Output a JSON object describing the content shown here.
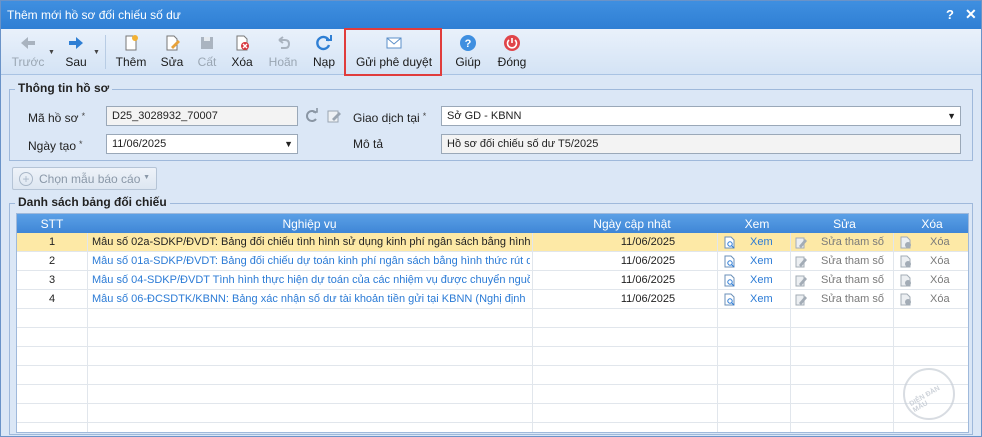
{
  "window": {
    "title": "Thêm mới hồ sơ đối chiếu số dư",
    "help": "?",
    "close": "✕"
  },
  "toolbar": {
    "prev": "Trước",
    "next": "Sau",
    "add": "Thêm",
    "edit": "Sửa",
    "save": "Cất",
    "delete": "Xóa",
    "undo": "Hoãn",
    "reload": "Nạp",
    "send": "Gửi phê duyệt",
    "help": "Giúp",
    "close": "Đóng"
  },
  "info": {
    "legend": "Thông tin hồ sơ",
    "code_label": "Mã hồ sơ",
    "code_value": "D25_3028932_70007",
    "date_label": "Ngày tạo",
    "date_value": "11/06/2025",
    "place_label": "Giao dịch tại",
    "place_value": "Sở GD - KBNN",
    "desc_label": "Mô tả",
    "desc_value": "Hồ sơ đối chiếu số dư T5/2025",
    "required_mark": "*"
  },
  "chooser": {
    "label": "Chọn mẫu báo cáo"
  },
  "list": {
    "legend": "Danh sách bảng đối chiếu",
    "headers": {
      "stt": "STT",
      "nv": "Nghiệp vụ",
      "date": "Ngày cập nhật",
      "view": "Xem",
      "edit": "Sửa",
      "del": "Xóa"
    },
    "rows": [
      {
        "stt": "1",
        "nv": "Mẫu số 02a-SDKP/ĐVDT: Bảng đối chiếu tình hình sử dụng kinh phí ngân sách bằng hình",
        "date": "11/06/2025",
        "view": "Xem",
        "edit": "Sửa tham số",
        "del": "Xóa"
      },
      {
        "stt": "2",
        "nv": "Mẫu số 01a-SDKP/ĐVDT: Bảng đối chiếu dự toán kinh phí ngân sách bằng hình thức rút d",
        "date": "11/06/2025",
        "view": "Xem",
        "edit": "Sửa tham số",
        "del": "Xóa"
      },
      {
        "stt": "3",
        "nv": "Mẫu số 04-SDKP/ĐVDT Tình hình thực hiện dự toán của các nhiệm vụ được chuyển nguồ",
        "date": "11/06/2025",
        "view": "Xem",
        "edit": "Sửa tham số",
        "del": "Xóa"
      },
      {
        "stt": "4",
        "nv": "Mẫu số 06-ĐCSDTK/KBNN: Bảng xác nhận số dư tài khoản tiền gửi tại KBNN (Nghị định",
        "date": "11/06/2025",
        "view": "Xem",
        "edit": "Sửa tham số",
        "del": "Xóa"
      }
    ]
  },
  "colors": {
    "title_bg": "#3f8fe0",
    "grid_header": "#4a93de",
    "selected_row": "#fde9a6",
    "link": "#2b7bd6",
    "highlight": "#e03c3c"
  },
  "watermark": "DIỄN ĐÀN MẪU"
}
